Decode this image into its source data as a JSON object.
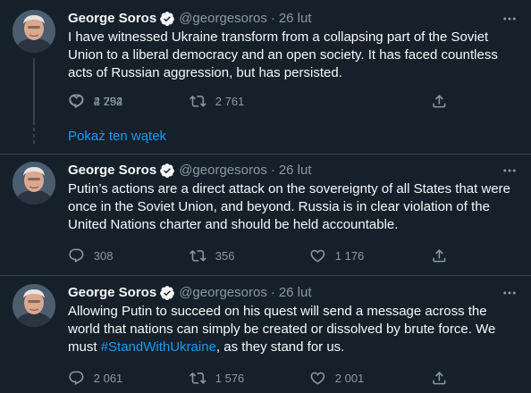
{
  "tweets": [
    {
      "name": "George Soros",
      "handle": "@georgesoros",
      "separator": "·",
      "time": "26 lut",
      "text_lines": [
        "I have witnessed Ukraine transform from a collapsing part of the Soviet",
        "Union to a liberal democracy and an open society. It has faced countless",
        "acts of Russian aggression, but has persisted."
      ],
      "replies": "2 794",
      "retweets": "2 761",
      "likes": "4 252"
    },
    {
      "name": "George Soros",
      "handle": "@georgesoros",
      "separator": "·",
      "time": "26 lut",
      "text_lines": [
        "Putin’s actions are a direct attack on the sovereignty of all States that were",
        "once in the Soviet Union, and beyond. Russia is in clear violation of the",
        "United Nations charter and should be held accountable."
      ],
      "replies": "308",
      "retweets": "356",
      "likes": "1 176"
    },
    {
      "name": "George Soros",
      "handle": "@georgesoros",
      "separator": "·",
      "time": "26 lut",
      "text_lines": [
        "Allowing Putin to succeed on his quest will send a message across the",
        "world that nations can simply be created or dissolved by brute force. We"
      ],
      "last_line_prefix": "must ",
      "hashtag": "#StandWithUkraine",
      "last_line_suffix": ", as they stand for us.",
      "replies": "2 061",
      "retweets": "1 576",
      "likes": "2 001"
    }
  ],
  "show_thread_label": "Pokaż ten wątek",
  "colors": {
    "background": "#15202b",
    "text": "#f7f9f9",
    "secondary": "#8b98a5",
    "accent": "#1d9bf0",
    "divider": "#38444d"
  },
  "icons": [
    "verified-badge-icon",
    "more-options-icon",
    "reply-icon",
    "retweet-icon",
    "like-icon",
    "share-icon"
  ]
}
